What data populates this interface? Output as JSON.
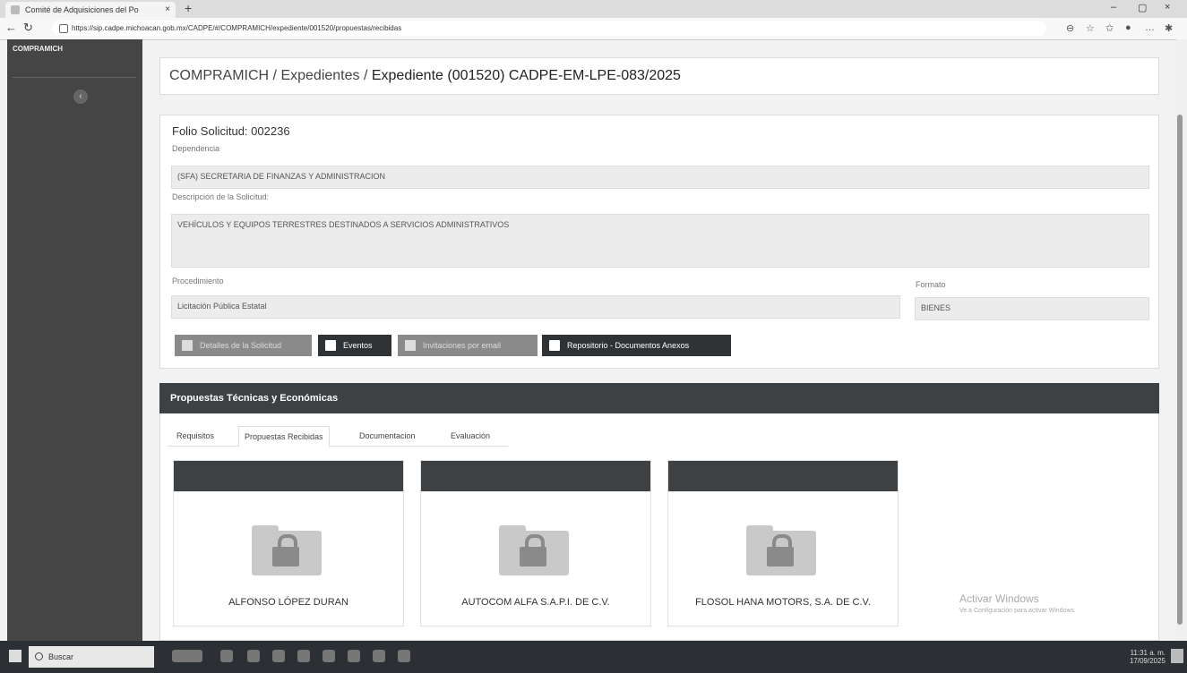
{
  "browser": {
    "tab_title": "Comité de Adquisiciones del Po",
    "tab_close": "×",
    "new_tab": "+",
    "url": "https://sip.cadpe.michoacan.gob.mx/CADPE/#/COMPRAMICH/expediente/001520/propuestas/recibidas",
    "minimize": "–",
    "maximize": "▢",
    "close": "×"
  },
  "sidebar": {
    "brand": "COMPRAMICH",
    "toggle_icon": "‹"
  },
  "header": {
    "crumb1": "COMPRAMICH",
    "sep1": " / ",
    "crumb2": "Expedientes",
    "sep2": " / ",
    "crumb3": "Expediente (001520) CADPE-EM-LPE-083/2025"
  },
  "solicitud": {
    "folio_label": "Folio Solicitud:",
    "folio_value": "002236",
    "dependencia_label": "Dependencia",
    "dependencia_value": "(SFA) SECRETARIA DE FINANZAS Y ADMINISTRACION",
    "descripcion_label": "Descripción de la Solicitud:",
    "descripcion_value": "VEHÍCULOS Y EQUIPOS TERRESTRES DESTINADOS A SERVICIOS ADMINISTRATIVOS",
    "procedimiento_label": "Procedimiento",
    "procedimiento_value": "Licitación Pública Estatal",
    "formato_label": "Formato",
    "formato_value": "BIENES"
  },
  "actions": {
    "detalles": "Detalles de la Solicitud",
    "eventos": "Eventos",
    "invitaciones": "Invitaciones por email",
    "repositorio": "Repositorio - Documentos Anexos"
  },
  "propuestas": {
    "title": "Propuestas Técnicas y Económicas",
    "tabs": [
      "Requisitos",
      "Propuestas Recibidas",
      "Documentacion",
      "Evaluación"
    ],
    "proveedores": [
      "ALFONSO LÓPEZ DURAN",
      "AUTOCOM ALFA S.A.P.I. DE C.V.",
      "FLOSOL HANA MOTORS, S.A. DE C.V."
    ]
  },
  "watermark": {
    "line1": "Activar Windows",
    "line2": "Ve a Configuración para activar Windows."
  },
  "taskbar": {
    "search_placeholder": "Buscar",
    "time": "11:31 a. m.",
    "date": "17/09/2025"
  }
}
